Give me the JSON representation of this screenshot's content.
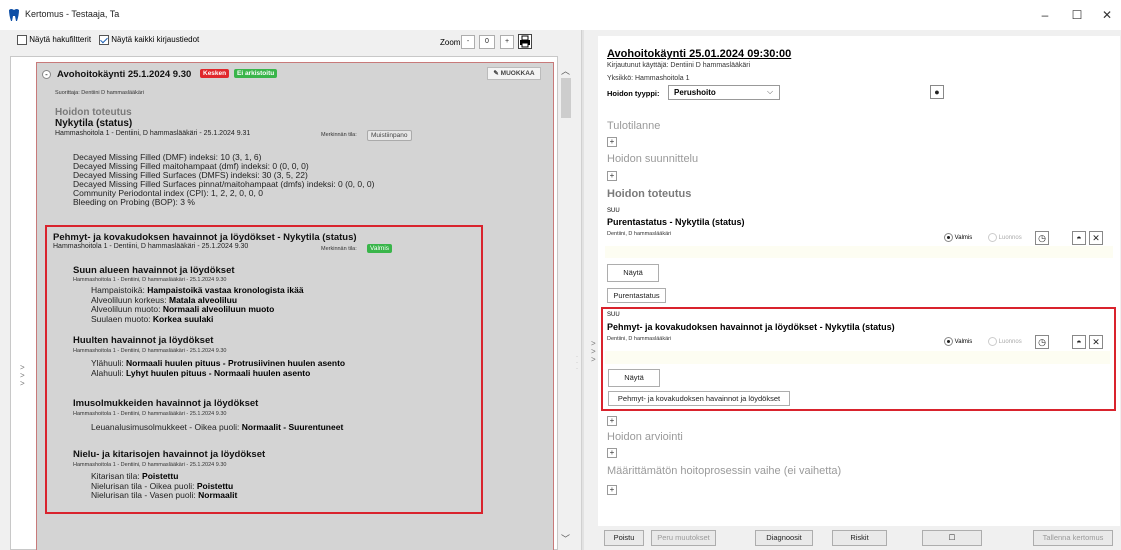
{
  "window": {
    "title": "Kertomus - Testaaja, Ta",
    "controls": [
      "–",
      "☐",
      "✕"
    ]
  },
  "left_toolbar": {
    "show_filters_label": "Näytä hakufiltterit",
    "show_all_label": "Näytä kaikki kirjaustiedot",
    "zoom_label": "Zoom",
    "zoom_minus": "-",
    "zoom_value": "0",
    "zoom_plus": "+"
  },
  "document": {
    "visit_title": "Avohoitokäynti 25.1.2024 9.30",
    "badge_kesken": "Kesken",
    "badge_ei_arkistoitu": "Ei arkistoitu",
    "edit_button": "MUOKKAA",
    "performer": "Suorittaja: Dentiini D hammaslääkäri",
    "care_heading": "Hoidon toteutus",
    "status_heading": "Nykytila (status)",
    "status_meta": "Hammashoitola 1 - Dentiini, D hammaslääkäri - 25.1.2024 9.31",
    "status_state_label": "Merkinnän tila:",
    "status_state_value": "Muistiinpano",
    "indices": [
      "Decayed Missing Filled (DMF) indeksi: 10 (3, 1, 6)",
      "Decayed Missing Filled maitohampaat (dmf) indeksi: 0 (0, 0, 0)",
      "Decayed Missing Filled Surfaces (DMFS) indeksi: 30 (3, 5, 22)",
      "Decayed Missing Filled Surfaces pinnat/maitohampaat (dmfs) indeksi: 0 (0, 0, 0)",
      "Community Periodontal index (CPI): 1, 2, 2, 0, 0, 0",
      "Bleeding on Probing (BOP): 3 %"
    ],
    "findings_heading": "Pehmyt- ja kovakudoksen havainnot ja löydökset - Nykytila (status)",
    "findings_meta": "Hammashoitola 1 - Dentiini, D hammaslääkäri - 25.1.2024 9.30",
    "findings_state_label": "Merkinnän tila:",
    "findings_state_value": "Valmis",
    "sub_meta": "Hammashoitola 1 - Dentiini, D hammaslääkäri - 25.1.2024 9.30",
    "mouth": {
      "heading": "Suun alueen havainnot ja löydökset",
      "rows": [
        {
          "label": "Hampaistoikä:",
          "value": "Hampaistoikä vastaa kronologista ikää"
        },
        {
          "label": "Alveoliluun korkeus:",
          "value": "Matala alveoliluu"
        },
        {
          "label": "Alveoliluun muoto:",
          "value": "Normaali alveoliluun muoto"
        },
        {
          "label": "Suulaen muoto:",
          "value": "Korkea suulaki"
        }
      ]
    },
    "lips": {
      "heading": "Huulten havainnot ja löydökset",
      "rows": [
        {
          "label": "Ylähuuli:",
          "value": "Normaali huulen pituus - Protrusiivinen huulen asento"
        },
        {
          "label": "Alahuuli:",
          "value": "Lyhyt huulen pituus - Normaali huulen asento"
        }
      ]
    },
    "glands": {
      "heading": "Imusolmukkeiden havainnot ja löydökset",
      "rows": [
        {
          "label": "Leuanalusimusolmukkeet - Oikea puoli:",
          "value": "Normaalit - Suurentuneet"
        }
      ]
    },
    "pharynx": {
      "heading": "Nielu- ja kitarisojen havainnot ja löydökset",
      "rows": [
        {
          "label": "Kitarisan tila:",
          "value": "Poistettu"
        },
        {
          "label": "Nielurisan tila - Oikea puoli:",
          "value": "Poistettu"
        },
        {
          "label": "Nielurisan tila - Vasen puoli:",
          "value": "Normaalit"
        }
      ]
    }
  },
  "right_form": {
    "visit_title": "Avohoitokäynti 25.01.2024 09:30:00",
    "logged_user": "Kirjautunut käyttäjä: Dentiini D hammaslääkäri",
    "unit": "Yksikkö: Hammashoitola 1",
    "care_type_label": "Hoidon tyyppi:",
    "care_type_value": "Perushoito",
    "sections": {
      "tulotilanne": "Tulotilanne",
      "suunnittelu": "Hoidon suunnittelu",
      "toteutus": "Hoidon toteutus",
      "arviointi": "Hoidon arviointi",
      "maarittamaton": "Määrittämätön hoitoprosessin vaihe (ei vaihetta)"
    },
    "entry1": {
      "tag": "SUU",
      "title": "Purentastatus - Nykytila (status)",
      "author": "Dentiini, D hammaslääkäri",
      "radio_valmis": "Valmis",
      "radio_luonnos": "Luonnos",
      "show_button": "Näytä",
      "link_button": "Purentastatus"
    },
    "entry2": {
      "tag": "SUU",
      "title": "Pehmyt- ja kovakudoksen havainnot ja löydökset - Nykytila (status)",
      "author": "Dentiini, D hammaslääkäri",
      "radio_valmis": "Valmis",
      "radio_luonnos": "Luonnos",
      "show_button": "Näytä",
      "link_button": "Pehmyt- ja kovakudoksen havainnot ja löydökset"
    },
    "bottom": {
      "poistu": "Poistu",
      "peru": "Peru muutokset",
      "diagnoosit": "Diagnoosit",
      "riskit": "Riskit",
      "square": "☐",
      "tallenna": "Tallenna kertomus"
    }
  },
  "colors": {
    "highlight_border": "#d9232d",
    "badge_red": "#e0282c",
    "badge_green": "#39b54a",
    "heading_gray": "#7a7a7a"
  }
}
